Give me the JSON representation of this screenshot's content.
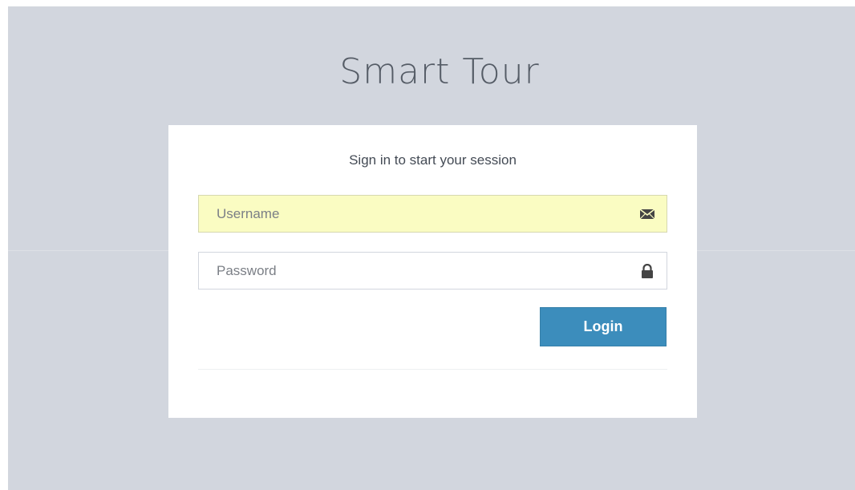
{
  "app": {
    "title": "Smart Tour"
  },
  "login": {
    "message": "Sign in to start your session",
    "username_placeholder": "Username",
    "username_value": "",
    "password_placeholder": "Password",
    "password_value": "",
    "submit_label": "Login"
  },
  "icons": {
    "username": "envelope-icon",
    "password": "lock-icon"
  },
  "colors": {
    "background": "#d2d6de",
    "card": "#ffffff",
    "autofill": "#fafcc2",
    "button": "#3c8dbc"
  }
}
